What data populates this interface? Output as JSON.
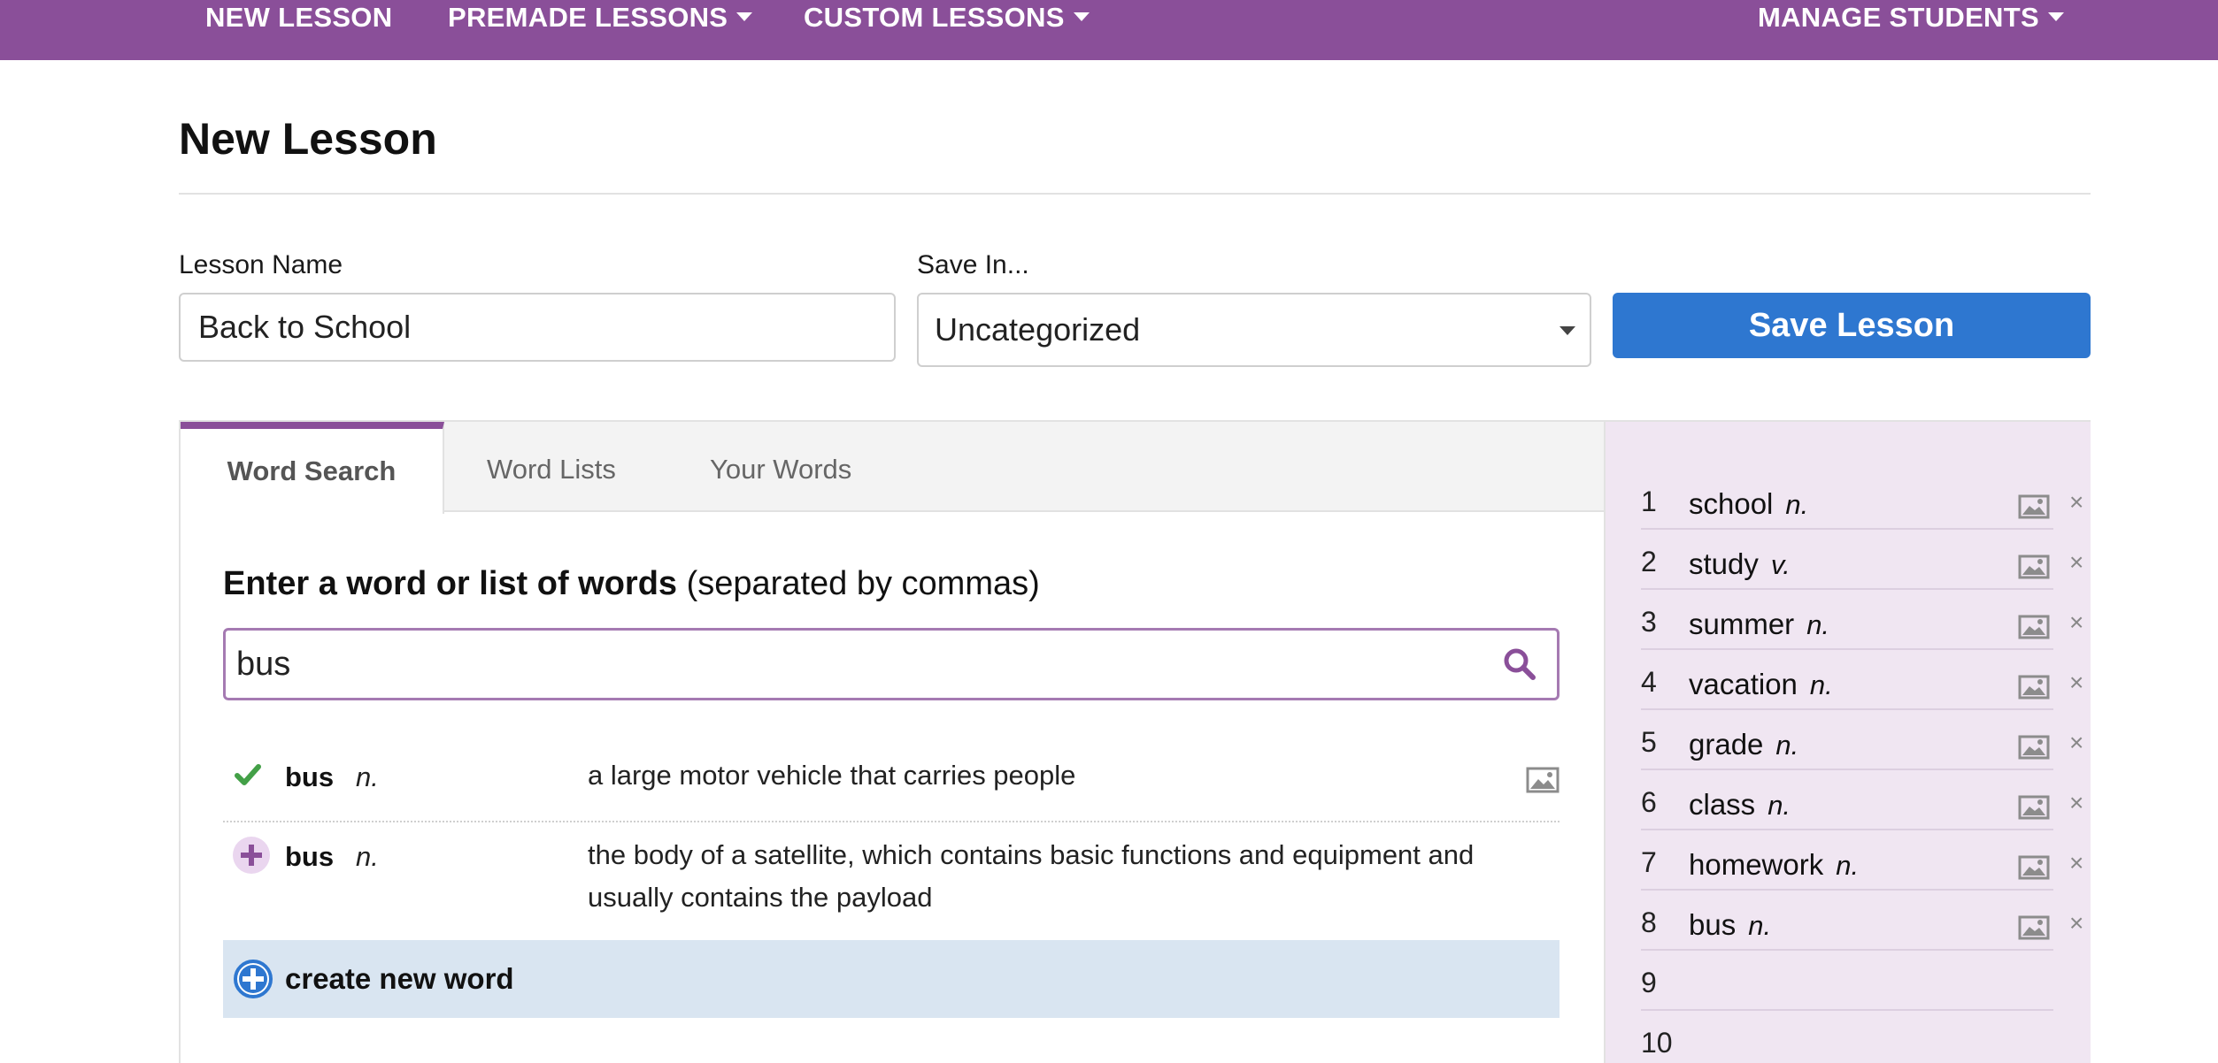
{
  "nav": {
    "items": [
      {
        "label": "NEW LESSON",
        "dropdown": false
      },
      {
        "label": "PREMADE LESSONS",
        "dropdown": true
      },
      {
        "label": "CUSTOM LESSONS",
        "dropdown": true
      },
      {
        "label": "MANAGE STUDENTS",
        "dropdown": true
      }
    ],
    "color": "#8a4f99"
  },
  "page": {
    "title": "New Lesson"
  },
  "form": {
    "lesson_name_label": "Lesson Name",
    "lesson_name_value": "Back to School",
    "save_in_label": "Save In...",
    "save_in_value": "Uncategorized",
    "save_button": "Save Lesson",
    "save_button_color": "#2e77d0"
  },
  "tabs": [
    {
      "label": "Word Search",
      "active": true
    },
    {
      "label": "Word Lists",
      "active": false
    },
    {
      "label": "Your Words",
      "active": false
    }
  ],
  "search": {
    "label_bold": "Enter a word or list of words",
    "label_rest": "(separated by commas)",
    "value": "bus",
    "icon": "search-icon"
  },
  "results": [
    {
      "word": "bus",
      "pos": "n.",
      "definition": "a large motor vehicle that carries people",
      "state": "added",
      "has_image": true
    },
    {
      "word": "bus",
      "pos": "n.",
      "definition": "the body of a satellite, which contains basic functions and equipment and usually contains the payload",
      "state": "add",
      "has_image": false
    }
  ],
  "create_new": {
    "label": "create new word"
  },
  "lesson_words": [
    {
      "num": "1",
      "word": "school",
      "pos": "n."
    },
    {
      "num": "2",
      "word": "study",
      "pos": "v."
    },
    {
      "num": "3",
      "word": "summer",
      "pos": "n."
    },
    {
      "num": "4",
      "word": "vacation",
      "pos": "n."
    },
    {
      "num": "5",
      "word": "grade",
      "pos": "n."
    },
    {
      "num": "6",
      "word": "class",
      "pos": "n."
    },
    {
      "num": "7",
      "word": "homework",
      "pos": "n."
    },
    {
      "num": "8",
      "word": "bus",
      "pos": "n."
    },
    {
      "num": "9",
      "word": "",
      "pos": ""
    },
    {
      "num": "10",
      "word": "",
      "pos": ""
    }
  ]
}
